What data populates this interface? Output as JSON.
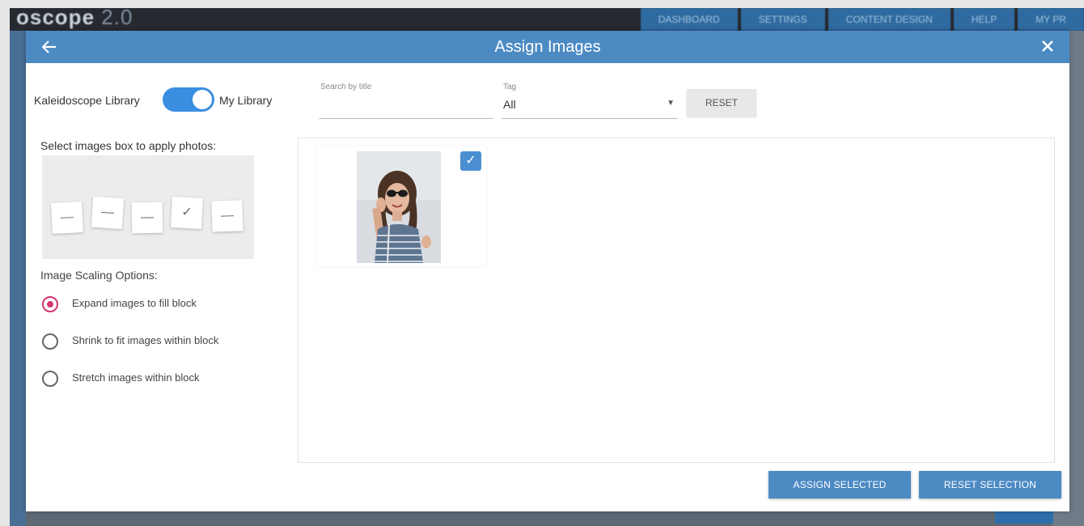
{
  "background_app": {
    "logo": "oscope",
    "logo_version": "2.0",
    "nav_items": [
      "DASHBOARD",
      "SETTINGS",
      "CONTENT DESIGN",
      "HELP",
      "MY PR"
    ]
  },
  "modal": {
    "title": "Assign Images",
    "back_icon": "arrow-left-icon",
    "close_icon": "close-icon"
  },
  "library_toggle": {
    "left_label": "Kaleidoscope Library",
    "right_label": "My Library",
    "state": "My Library"
  },
  "filters": {
    "search_label": "Search by title",
    "search_value": "",
    "tag_label": "Tag",
    "tag_value": "All",
    "reset_label": "RESET"
  },
  "image_boxes": {
    "label": "Select images box to apply photos:",
    "boxes": [
      {
        "glyph": "—",
        "selected": false
      },
      {
        "glyph": "—",
        "selected": false
      },
      {
        "glyph": "—",
        "selected": false
      },
      {
        "glyph": "✓",
        "selected": true
      },
      {
        "glyph": "—",
        "selected": false
      }
    ]
  },
  "scaling": {
    "label": "Image Scaling Options:",
    "options": [
      {
        "label": "Expand images to fill block",
        "checked": true
      },
      {
        "label": "Shrink to fit images within block",
        "checked": false
      },
      {
        "label": "Stretch images within block",
        "checked": false
      }
    ]
  },
  "gallery": {
    "items": [
      {
        "image": "woman-with-sunglasses-photo",
        "checked": true
      }
    ]
  },
  "buttons": {
    "assign": "ASSIGN SELECTED",
    "reset_selection": "RESET SELECTION"
  },
  "colors": {
    "header": "#4c8ac4",
    "toggle": "#3a8ee0",
    "radio_checked": "#d63572",
    "checkbox": "#4b8fd2"
  }
}
